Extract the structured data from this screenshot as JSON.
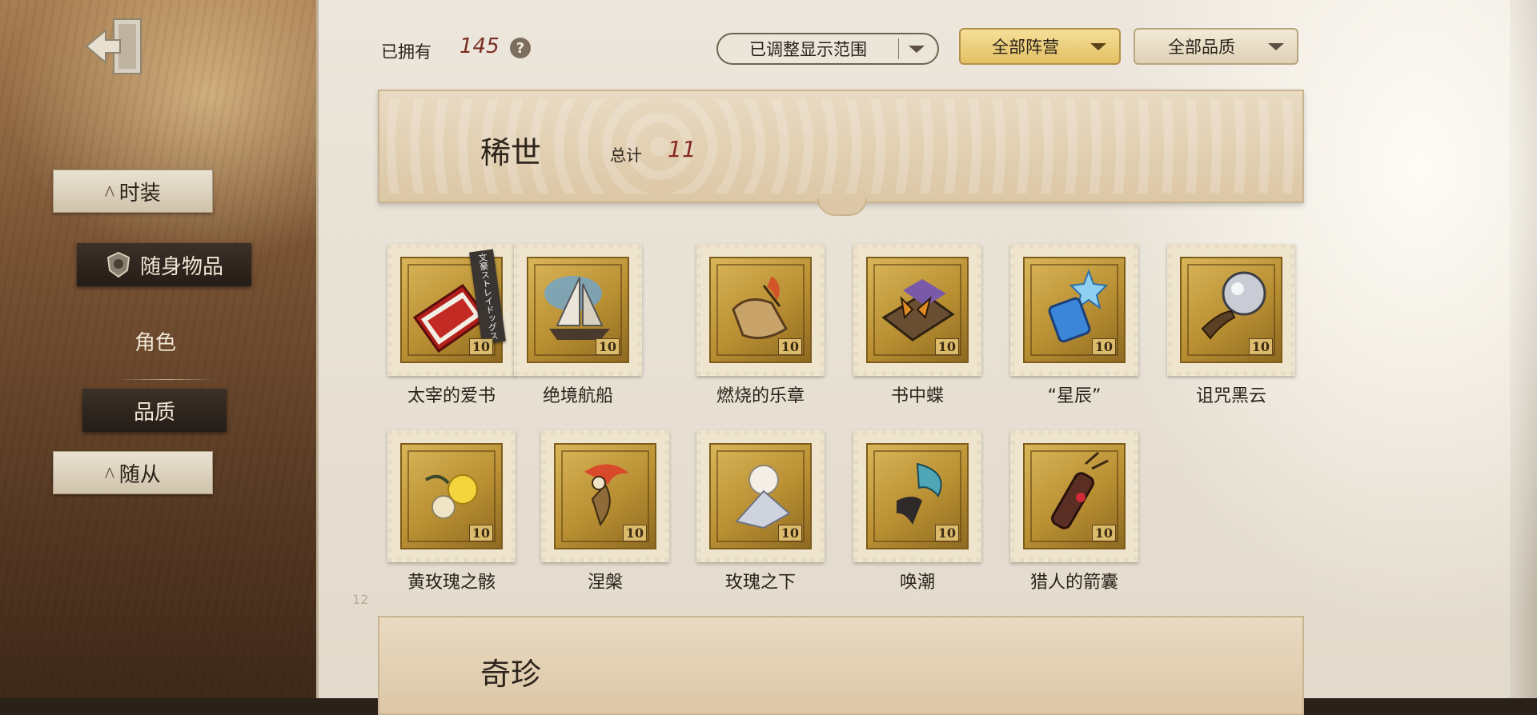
{
  "top_bar": {
    "owned_label": "已拥有",
    "owned_count": "145",
    "help": "?",
    "filter_range": "已调整显示范围",
    "filter_faction": "全部阵营",
    "filter_quality": "全部品质"
  },
  "sidebar": {
    "items": [
      {
        "label": "时装",
        "state": "inactive"
      },
      {
        "label": "随身物品",
        "state": "active"
      },
      {
        "label": "角色",
        "state": "plain"
      },
      {
        "label": "品质",
        "state": "selected"
      },
      {
        "label": "随从",
        "state": "inactive"
      }
    ]
  },
  "section": {
    "title": "稀世",
    "total_label": "总计",
    "total_value": "11",
    "next_title_partial": "奇珍"
  },
  "items": [
    {
      "name": "太宰的爱书",
      "icon": "red-book-icon",
      "quality": "10",
      "tag": "文豪ストレイドッグス"
    },
    {
      "name": "绝境航船",
      "icon": "sailing-ship-icon",
      "quality": "10"
    },
    {
      "name": "燃烧的乐章",
      "icon": "burning-scroll-icon",
      "quality": "10"
    },
    {
      "name": "书中蝶",
      "icon": "butterfly-book-icon",
      "quality": "10"
    },
    {
      "name": "“星辰”",
      "icon": "star-crystal-icon",
      "quality": "10"
    },
    {
      "name": "诅咒黑云",
      "icon": "crystal-orb-icon",
      "quality": "10"
    },
    {
      "name": "黄玫瑰之骸",
      "icon": "yellow-rose-icon",
      "quality": "10"
    },
    {
      "name": "涅槃",
      "icon": "phoenix-icon",
      "quality": "10"
    },
    {
      "name": "玫瑰之下",
      "icon": "white-rose-icon",
      "quality": "10"
    },
    {
      "name": "唤潮",
      "icon": "tide-staff-icon",
      "quality": "10"
    },
    {
      "name": "猎人的箭囊",
      "icon": "quiver-icon",
      "quality": "10"
    }
  ],
  "page_number": "12",
  "colors": {
    "stamp_gold": "#c9a246",
    "accent_red": "#8a2a22",
    "faction_dropdown": "#f0d483"
  }
}
